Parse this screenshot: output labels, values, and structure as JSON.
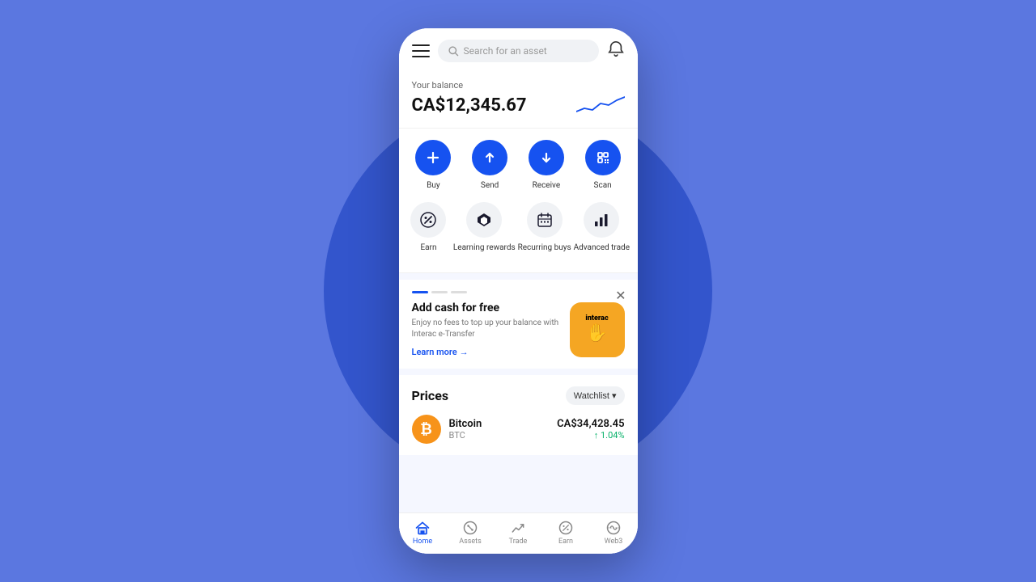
{
  "background": {
    "color": "#5b77e0",
    "circle_color": "#3355cc"
  },
  "header": {
    "search_placeholder": "Search for an asset"
  },
  "balance": {
    "label": "Your balance",
    "amount": "CA$12,345.67"
  },
  "actions_row1": [
    {
      "id": "buy",
      "label": "Buy",
      "icon": "plus",
      "circle": "blue"
    },
    {
      "id": "send",
      "label": "Send",
      "icon": "arrow-up",
      "circle": "blue"
    },
    {
      "id": "receive",
      "label": "Receive",
      "icon": "arrow-down",
      "circle": "blue"
    },
    {
      "id": "scan",
      "label": "Scan",
      "icon": "scan",
      "circle": "blue"
    }
  ],
  "actions_row2": [
    {
      "id": "earn",
      "label": "Earn",
      "icon": "percent",
      "circle": "white"
    },
    {
      "id": "learning",
      "label": "Learning rewards",
      "icon": "diamond",
      "circle": "white"
    },
    {
      "id": "recurring",
      "label": "Recurring buys",
      "icon": "calendar",
      "circle": "white"
    },
    {
      "id": "advanced",
      "label": "Advanced trade",
      "icon": "chart-bar",
      "circle": "white"
    }
  ],
  "banner": {
    "title": "Add cash for free",
    "description": "Enjoy no fees to top up your balance with Interac e-Transfer",
    "link_text": "Learn more",
    "interac_label": "Interac"
  },
  "prices": {
    "title": "Prices",
    "watchlist_label": "Watchlist",
    "assets": [
      {
        "name": "Bitcoin",
        "ticker": "BTC",
        "price": "CA$34,428.45",
        "change": "↑ 1.04%",
        "change_positive": true
      }
    ]
  },
  "bottom_nav": [
    {
      "id": "home",
      "label": "Home",
      "active": true
    },
    {
      "id": "assets",
      "label": "Assets",
      "active": false
    },
    {
      "id": "trade",
      "label": "Trade",
      "active": false
    },
    {
      "id": "earn",
      "label": "Earn",
      "active": false
    },
    {
      "id": "web3",
      "label": "Web3",
      "active": false
    }
  ]
}
